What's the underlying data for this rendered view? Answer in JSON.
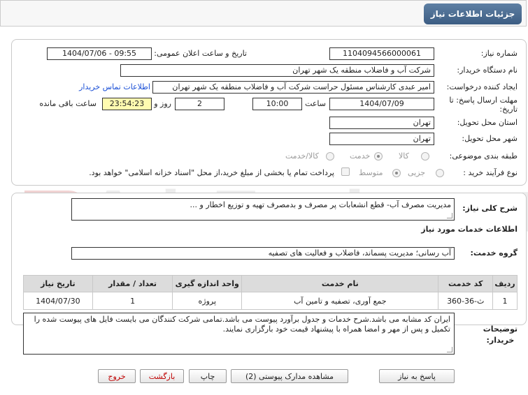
{
  "header": {
    "title": "جزئیات اطلاعات نیاز"
  },
  "form": {
    "need_number_label": "شماره نیاز:",
    "need_number": "1104094566000061",
    "announce_label": "تاریخ و ساعت اعلان عمومی:",
    "announce_value": "1404/07/06 - 09:55",
    "buyer_org_label": "نام دستگاه خریدار:",
    "buyer_org": "شرکت آب و فاضلاب منطقه یک شهر تهران",
    "requester_label": "ایجاد کننده درخواست:",
    "requester": "امیر عبدی کارشناس مسئول حراست شرکت آب و فاضلاب منطقه یک شهر تهران",
    "contact_link": "اطلاعات تماس خریدار",
    "deadline_label_1": "مهلت ارسال پاسخ: تا",
    "deadline_label_2": "تاریخ:",
    "deadline_date": "1404/07/09",
    "time_label": "ساعت",
    "deadline_time": "10:00",
    "days": "2",
    "days_label": "روز و",
    "remaining": "23:54:23",
    "remaining_label": "ساعت باقی مانده",
    "province_label": "استان محل تحویل:",
    "province": "تهران",
    "city_label": "شهر محل تحویل:",
    "city": "تهران",
    "category_label": "طبقه بندی موضوعی:",
    "category_options": [
      "کالا",
      "خدمت",
      "کالا/خدمت"
    ],
    "category_selected": "خدمت",
    "process_label": "نوع فرآیند خرید :",
    "process_options": [
      "جزیی",
      "متوسط"
    ],
    "process_selected": "متوسط",
    "payment_note": "پرداخت تمام یا بخشی از مبلغ خرید،از محل \"اسناد خزانه اسلامی\" خواهد بود."
  },
  "summary": {
    "label": "شرح کلی نیاز:",
    "value": "مدیریت مصرف آب- قطع انشعابات پر مصرف و بدمصرف تهیه و توزیع اخطار و ..."
  },
  "services": {
    "section_title": "اطلاعات خدمات مورد نیاز",
    "group_label": "گروه خدمت:",
    "group_value": "آب رسانی؛ مدیریت پسماند، فاضلاب و فعالیت های تصفیه",
    "columns": [
      "ردیف",
      "کد خدمت",
      "نام خدمت",
      "واحد اندازه گیری",
      "تعداد / مقدار",
      "تاریخ نیاز"
    ],
    "rows": [
      [
        "1",
        "ث-36-360",
        "جمع آوری، تصفیه و تامین آب",
        "پروژه",
        "1",
        "1404/07/30"
      ]
    ]
  },
  "buyer_notes": {
    "label_1": "توضیحات",
    "label_2": "خریدار:",
    "text": "ایران کد مشابه می باشد.شرح خدمات و جدول برآورد پیوست می باشد.تمامی شرکت کنندگان می بایست فایل های پیوست شده را تکمیل و پس از مهر و امضا همراه با پیشنهاد قیمت خود بارگزاری نمایند."
  },
  "buttons": {
    "reply": "پاسخ به نیاز",
    "attachments": "مشاهده مدارک پیوستی (2)",
    "print": "چاپ",
    "back": "بازگشت",
    "exit": "خروج"
  },
  "watermark": {
    "text": "AriaTender.net"
  },
  "colors": {
    "header_tab": "#4a6b90",
    "link": "#1a4fd6",
    "timer_bg": "#fffbb0",
    "exit_text": "#c00000"
  }
}
